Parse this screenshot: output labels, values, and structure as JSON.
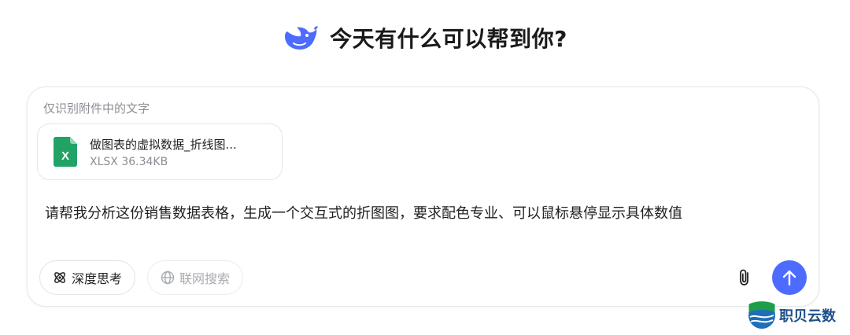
{
  "header": {
    "title": "今天有什么可以帮到你?",
    "logo_icon": "whale-logo-icon"
  },
  "chat": {
    "hint": "仅识别附件中的文字",
    "attachment": {
      "name": "做图表的虚拟数据_折线图...",
      "meta": "XLSX 36.34KB",
      "icon": "excel-file-icon"
    },
    "prompt": "请帮我分析这份销售数据表格，生成一个交互式的折图图，要求配色专业、可以鼠标悬停显示具体数值",
    "buttons": {
      "deep_think": "深度思考",
      "web_search": "联网搜索"
    }
  },
  "watermark": {
    "text": "职贝云数"
  },
  "colors": {
    "accent": "#4d6bfe",
    "excel_green": "#21a366",
    "border": "#e6e7eb",
    "muted_text": "#8a8d93"
  }
}
